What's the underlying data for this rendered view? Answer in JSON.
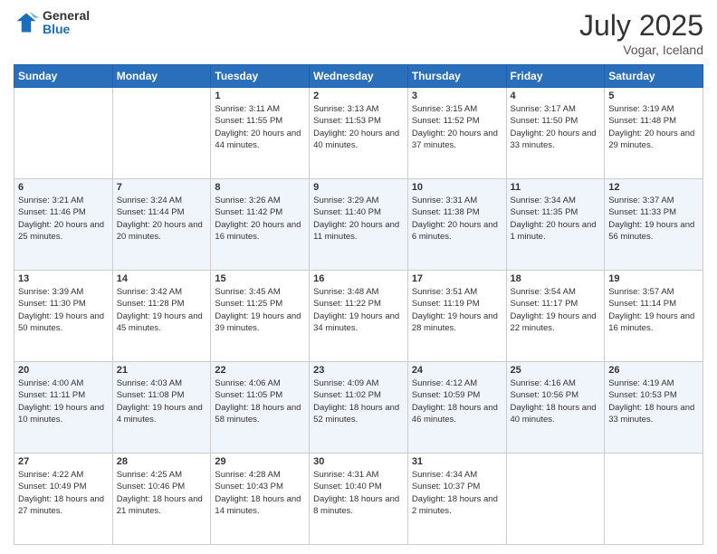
{
  "header": {
    "logo": {
      "line1": "General",
      "line2": "Blue"
    },
    "title": "July 2025",
    "location": "Vogar, Iceland"
  },
  "weekdays": [
    "Sunday",
    "Monday",
    "Tuesday",
    "Wednesday",
    "Thursday",
    "Friday",
    "Saturday"
  ],
  "weeks": [
    [
      {
        "day": "",
        "info": ""
      },
      {
        "day": "",
        "info": ""
      },
      {
        "day": "1",
        "info": "Sunrise: 3:11 AM\nSunset: 11:55 PM\nDaylight: 20 hours and 44 minutes."
      },
      {
        "day": "2",
        "info": "Sunrise: 3:13 AM\nSunset: 11:53 PM\nDaylight: 20 hours and 40 minutes."
      },
      {
        "day": "3",
        "info": "Sunrise: 3:15 AM\nSunset: 11:52 PM\nDaylight: 20 hours and 37 minutes."
      },
      {
        "day": "4",
        "info": "Sunrise: 3:17 AM\nSunset: 11:50 PM\nDaylight: 20 hours and 33 minutes."
      },
      {
        "day": "5",
        "info": "Sunrise: 3:19 AM\nSunset: 11:48 PM\nDaylight: 20 hours and 29 minutes."
      }
    ],
    [
      {
        "day": "6",
        "info": "Sunrise: 3:21 AM\nSunset: 11:46 PM\nDaylight: 20 hours and 25 minutes."
      },
      {
        "day": "7",
        "info": "Sunrise: 3:24 AM\nSunset: 11:44 PM\nDaylight: 20 hours and 20 minutes."
      },
      {
        "day": "8",
        "info": "Sunrise: 3:26 AM\nSunset: 11:42 PM\nDaylight: 20 hours and 16 minutes."
      },
      {
        "day": "9",
        "info": "Sunrise: 3:29 AM\nSunset: 11:40 PM\nDaylight: 20 hours and 11 minutes."
      },
      {
        "day": "10",
        "info": "Sunrise: 3:31 AM\nSunset: 11:38 PM\nDaylight: 20 hours and 6 minutes."
      },
      {
        "day": "11",
        "info": "Sunrise: 3:34 AM\nSunset: 11:35 PM\nDaylight: 20 hours and 1 minute."
      },
      {
        "day": "12",
        "info": "Sunrise: 3:37 AM\nSunset: 11:33 PM\nDaylight: 19 hours and 56 minutes."
      }
    ],
    [
      {
        "day": "13",
        "info": "Sunrise: 3:39 AM\nSunset: 11:30 PM\nDaylight: 19 hours and 50 minutes."
      },
      {
        "day": "14",
        "info": "Sunrise: 3:42 AM\nSunset: 11:28 PM\nDaylight: 19 hours and 45 minutes."
      },
      {
        "day": "15",
        "info": "Sunrise: 3:45 AM\nSunset: 11:25 PM\nDaylight: 19 hours and 39 minutes."
      },
      {
        "day": "16",
        "info": "Sunrise: 3:48 AM\nSunset: 11:22 PM\nDaylight: 19 hours and 34 minutes."
      },
      {
        "day": "17",
        "info": "Sunrise: 3:51 AM\nSunset: 11:19 PM\nDaylight: 19 hours and 28 minutes."
      },
      {
        "day": "18",
        "info": "Sunrise: 3:54 AM\nSunset: 11:17 PM\nDaylight: 19 hours and 22 minutes."
      },
      {
        "day": "19",
        "info": "Sunrise: 3:57 AM\nSunset: 11:14 PM\nDaylight: 19 hours and 16 minutes."
      }
    ],
    [
      {
        "day": "20",
        "info": "Sunrise: 4:00 AM\nSunset: 11:11 PM\nDaylight: 19 hours and 10 minutes."
      },
      {
        "day": "21",
        "info": "Sunrise: 4:03 AM\nSunset: 11:08 PM\nDaylight: 19 hours and 4 minutes."
      },
      {
        "day": "22",
        "info": "Sunrise: 4:06 AM\nSunset: 11:05 PM\nDaylight: 18 hours and 58 minutes."
      },
      {
        "day": "23",
        "info": "Sunrise: 4:09 AM\nSunset: 11:02 PM\nDaylight: 18 hours and 52 minutes."
      },
      {
        "day": "24",
        "info": "Sunrise: 4:12 AM\nSunset: 10:59 PM\nDaylight: 18 hours and 46 minutes."
      },
      {
        "day": "25",
        "info": "Sunrise: 4:16 AM\nSunset: 10:56 PM\nDaylight: 18 hours and 40 minutes."
      },
      {
        "day": "26",
        "info": "Sunrise: 4:19 AM\nSunset: 10:53 PM\nDaylight: 18 hours and 33 minutes."
      }
    ],
    [
      {
        "day": "27",
        "info": "Sunrise: 4:22 AM\nSunset: 10:49 PM\nDaylight: 18 hours and 27 minutes."
      },
      {
        "day": "28",
        "info": "Sunrise: 4:25 AM\nSunset: 10:46 PM\nDaylight: 18 hours and 21 minutes."
      },
      {
        "day": "29",
        "info": "Sunrise: 4:28 AM\nSunset: 10:43 PM\nDaylight: 18 hours and 14 minutes."
      },
      {
        "day": "30",
        "info": "Sunrise: 4:31 AM\nSunset: 10:40 PM\nDaylight: 18 hours and 8 minutes."
      },
      {
        "day": "31",
        "info": "Sunrise: 4:34 AM\nSunset: 10:37 PM\nDaylight: 18 hours and 2 minutes."
      },
      {
        "day": "",
        "info": ""
      },
      {
        "day": "",
        "info": ""
      }
    ]
  ]
}
